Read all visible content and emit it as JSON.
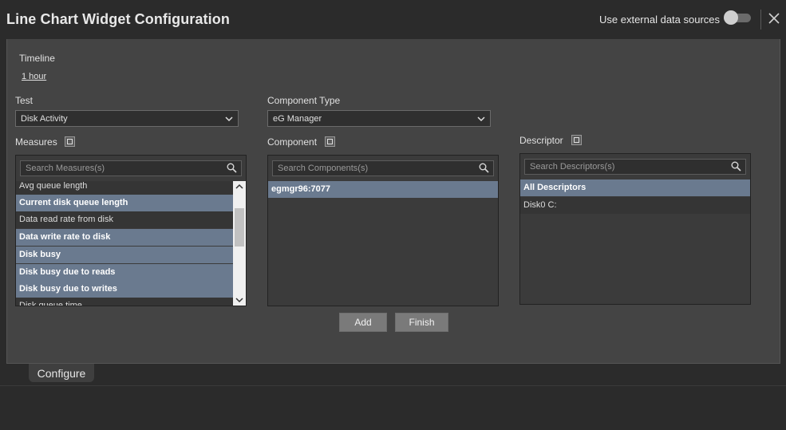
{
  "header": {
    "title": "Line Chart Widget Configuration",
    "external_label": "Use external data sources",
    "external_enabled": false
  },
  "timeline": {
    "label": "Timeline",
    "value": "1 hour"
  },
  "test": {
    "label": "Test",
    "value": "Disk Activity"
  },
  "component_type": {
    "label": "Component Type",
    "value": "eG Manager"
  },
  "measures": {
    "label": "Measures",
    "placeholder": "Search Measures(s)",
    "items": [
      {
        "label": "Avg queue length",
        "selected": false
      },
      {
        "label": "Current disk queue length",
        "selected": true
      },
      {
        "label": "Data read rate from disk",
        "selected": false
      },
      {
        "label": "Data write rate to disk",
        "selected": true
      },
      {
        "label": "Disk busy",
        "selected": true
      },
      {
        "label": "Disk busy due to reads",
        "selected": true
      },
      {
        "label": "Disk busy due to writes",
        "selected": true
      },
      {
        "label": "Disk queue time",
        "selected": false
      }
    ]
  },
  "component": {
    "label": "Component",
    "placeholder": "Search Components(s)",
    "items": [
      {
        "label": "egmgr96:7077",
        "selected": true
      }
    ]
  },
  "descriptor": {
    "label": "Descriptor",
    "placeholder": "Search Descriptors(s)",
    "items": [
      {
        "label": "All Descriptors",
        "selected": true
      },
      {
        "label": "Disk0 C:",
        "selected": false
      }
    ]
  },
  "buttons": {
    "add": "Add",
    "finish": "Finish"
  },
  "tabs": {
    "configure": "Configure"
  },
  "colors": {
    "selected_row": "#6a7a8f",
    "panel": "#444444",
    "background": "#2b2b2b"
  }
}
